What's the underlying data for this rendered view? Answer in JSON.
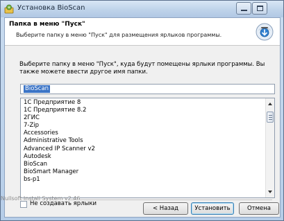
{
  "window": {
    "title": "Установка BioScan",
    "icon": "installer-icon"
  },
  "header": {
    "title": "Папка в меню \"Пуск\"",
    "subtitle": "Выберите папку в меню \"Пуск\" для размещения ярлыков программы.",
    "icon": "cd-install-icon"
  },
  "intro_text": "Выберите папку в меню \"Пуск\", куда будут помещены ярлыки программы. Вы также можете ввести другое имя папки.",
  "folder_input": {
    "value": "BioScan"
  },
  "folder_list": [
    "1С Предприятие 8",
    "1С Предприятие 8.2",
    "2ГИС",
    "7-Zip",
    "Accessories",
    "Administrative Tools",
    "Advanced IP Scanner v2",
    "Autodesk",
    "BioScan",
    "BioSmart Manager",
    "bs-p1"
  ],
  "no_shortcuts_checkbox": {
    "label": "Не создавать ярлыки",
    "checked": false
  },
  "branding": "Nullsoft Install System v2.46",
  "buttons": {
    "back": "< Назад",
    "install": "Установить",
    "cancel": "Отмена"
  },
  "colors": {
    "selection": "#3b74c6",
    "titlebar": "#bfd3ea",
    "face": "#f0f0f0"
  }
}
